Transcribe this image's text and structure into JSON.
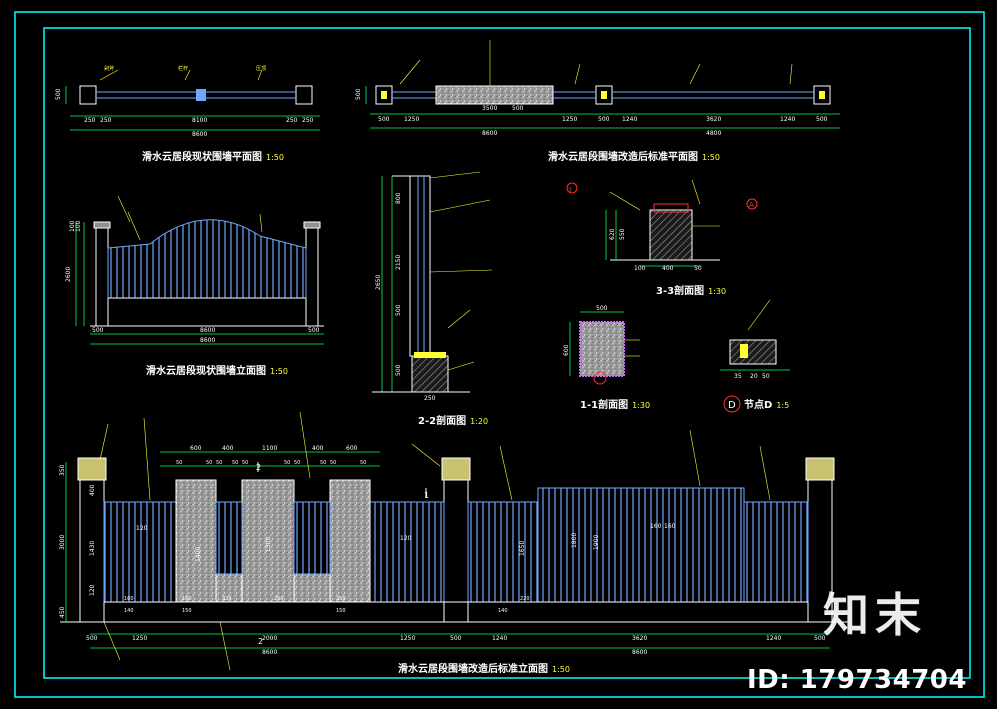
{
  "colors": {
    "background": "#000000",
    "frame": "#00ffff",
    "outline": "#ffffff",
    "fence": "#6fa8ff",
    "dimension": "#00ff66",
    "label": "#ffff33",
    "note": "#ff3030",
    "stone": "#bdbdbd",
    "brick": "#8f8f8f"
  },
  "titles": {
    "plan_original": "滑水云居段现状围墙平面图",
    "plan_new": "滑水云居段围墙改造后标准平面图",
    "elev_original": "滑水云居段现状围墙立面图",
    "elev_new": "滑水云居段围墙改造后标准立面图",
    "sec_33": "3-3剖面图",
    "sec_11": "1-1剖面图",
    "sec_22": "2-2剖面图",
    "node_d": "节点D",
    "scale_50": "1:50",
    "scale_30": "1:30",
    "scale_20": "1:20",
    "scale_5": "1:5"
  },
  "plan_original_dims": [
    "250",
    "250",
    "8100",
    "250",
    "250",
    "8600",
    "500"
  ],
  "plan_new_dims": [
    "500",
    "1250",
    "3500",
    "1250",
    "500",
    "1240",
    "3620",
    "1240",
    "500",
    "8600",
    "4800",
    "500",
    "500"
  ],
  "elev_original_dims": [
    "500",
    "8600",
    "500",
    "8600",
    "100",
    "2600",
    "100"
  ],
  "sec22_dims": [
    "800",
    "2150",
    "2650",
    "500",
    "500",
    "250"
  ],
  "elev_new_top_dims": [
    "600",
    "400",
    "1100",
    "400",
    "600",
    "50",
    "50",
    "50",
    "50",
    "50",
    "50",
    "50",
    "50",
    "50",
    "50"
  ],
  "elev_new_bottom_dims": [
    "500",
    "1250",
    "2000",
    "1250",
    "500",
    "1240",
    "3620",
    "1240",
    "500",
    "8600",
    "8600"
  ],
  "elev_new_left_dims": [
    "350",
    "400",
    "1430",
    "3000",
    "120",
    "450"
  ],
  "elev_new_inner_dims": [
    "120",
    "120",
    "1400",
    "1650",
    "1800",
    "1900",
    "1500",
    "160",
    "160",
    "220",
    "250",
    "250",
    "220",
    "140",
    "140",
    "150",
    "150",
    "160",
    "160"
  ],
  "sec11_dims": [
    "500",
    "600"
  ],
  "sec33_dims": [
    "620",
    "550",
    "100",
    "400",
    "50"
  ],
  "node_d_dims": [
    "35",
    "20",
    "50"
  ],
  "markers": {
    "a": "A",
    "d": "D",
    "one": "1",
    "two": "2",
    "three": "3"
  },
  "watermark": {
    "logo": "知末",
    "id": "ID: 179734704"
  }
}
